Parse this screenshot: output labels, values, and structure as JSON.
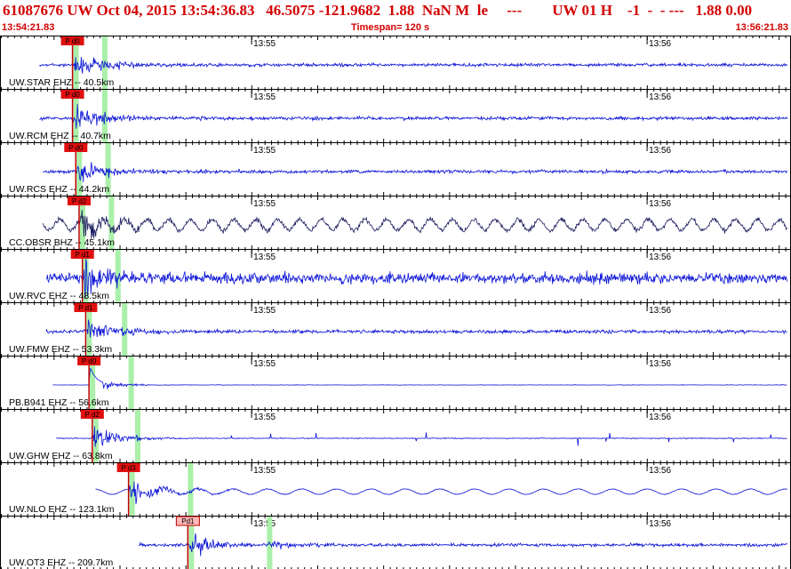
{
  "header": {
    "title": "61087676 UW Oct 04, 2015 13:54:36.83   46.5075 -121.9682  1.88  NaN M  le     ---        UW 01 H    -1  -  - ---   1.88 0.00",
    "start_time": "13:54:21.83",
    "timespan": "Timespan= 120 s",
    "end_time": "13:56:21.83"
  },
  "time_ticks": [
    "13:55",
    "13:56"
  ],
  "colors": {
    "header_text": "#d40000",
    "trace_ehz": "#0a12d6",
    "trace_bhz": "#1b1b5e",
    "pick_box": "#e01010",
    "pick_box_selected": "#ffb8b8",
    "pick_line": "#c00000",
    "window_marker": "#aaf0aa",
    "frame": "#000000"
  },
  "traces": [
    {
      "label": "UW.STAR EHZ -- 40.5km",
      "pick": "P d0",
      "selected": false,
      "data_start_s": 6,
      "pick_s": 11,
      "s_s": 15.5,
      "amp": 0.28,
      "style": "ehz"
    },
    {
      "label": "UW.RCM EHZ -- 40.7km",
      "pick": "P d0",
      "selected": false,
      "data_start_s": 6,
      "pick_s": 11,
      "s_s": 15.5,
      "amp": 0.3,
      "style": "ehz"
    },
    {
      "label": "UW.RCS EHZ -- 44.2km",
      "pick": "P d0",
      "selected": false,
      "data_start_s": 6.5,
      "pick_s": 11.5,
      "s_s": 16,
      "amp": 0.3,
      "style": "ehz"
    },
    {
      "label": "CC.OBSR BHZ -- 45.1km",
      "pick": "P d2",
      "selected": false,
      "data_start_s": 6.5,
      "pick_s": 12,
      "s_s": 16.5,
      "amp": 0.35,
      "style": "bhz"
    },
    {
      "label": "UW.RVC EHZ -- 48.5km",
      "pick": "P d1",
      "selected": false,
      "data_start_s": 7,
      "pick_s": 12.5,
      "s_s": 17.5,
      "amp": 0.4,
      "style": "noisy"
    },
    {
      "label": "UW.FMW EHZ -- 53.3km",
      "pick": "P d1",
      "selected": false,
      "data_start_s": 7,
      "pick_s": 13,
      "s_s": 18.5,
      "amp": 0.3,
      "style": "ehz"
    },
    {
      "label": "PB.B941 EHZ -- 56.6km",
      "pick": "P d0",
      "selected": false,
      "data_start_s": 8,
      "pick_s": 13.5,
      "s_s": 19.5,
      "amp": 0.06,
      "style": "flat"
    },
    {
      "label": "UW.GHW EHZ -- 63.8km",
      "pick": "P d2",
      "selected": false,
      "data_start_s": 8.5,
      "pick_s": 14,
      "s_s": 20.5,
      "amp": 0.12,
      "style": "spiky"
    },
    {
      "label": "UW.NLO EHZ -- 123.1km",
      "pick": "P d3",
      "selected": false,
      "data_start_s": 14.5,
      "pick_s": 19.5,
      "s_s": 28.5,
      "amp": 0.12,
      "style": "long"
    },
    {
      "label": "UW.OT3 EHZ -- 209.7km",
      "pick": "Pd1",
      "selected": true,
      "data_start_s": 21,
      "pick_s": 28.5,
      "s_s": 40.5,
      "amp": 0.28,
      "style": "ehz"
    }
  ]
}
